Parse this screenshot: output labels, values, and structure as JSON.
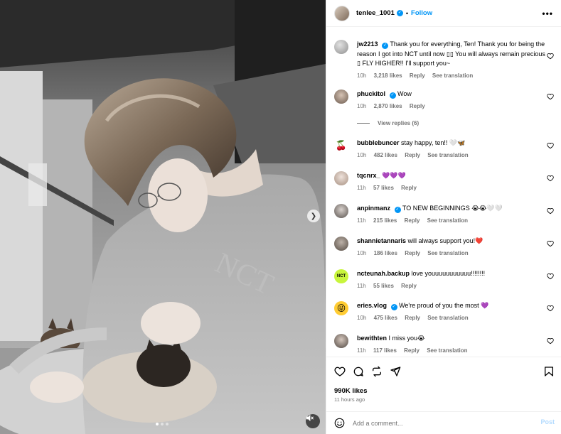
{
  "post": {
    "author": "tenlee_1001",
    "separator": "•",
    "follow_label": "Follow",
    "more_label": "•••",
    "likes": "990K likes",
    "time_ago": "11 hours ago",
    "comment_placeholder": "Add a comment...",
    "post_label": "Post",
    "carousel_count": 3,
    "carousel_active": 0
  },
  "comments": [
    {
      "user": "jw2213",
      "verified": true,
      "text": "Thank you for everything, Ten! Thank you for being the reason I got into NCT until now ▯▯ You will always remain precious ▯ FLY HIGHER!! I'll support you~",
      "time": "10h",
      "likes": "3,218 likes",
      "reply": "Reply",
      "translate": "See translation"
    },
    {
      "user": "phuckitol",
      "verified": true,
      "text": "Wow",
      "time": "10h",
      "likes": "2,870 likes",
      "reply": "Reply",
      "translate": ""
    },
    {
      "user": "bubblebuncer",
      "verified": false,
      "text": "stay happy, ten!! 🤍🦋",
      "time": "10h",
      "likes": "482 likes",
      "reply": "Reply",
      "translate": "See translation"
    },
    {
      "user": "tqcnrx_",
      "verified": false,
      "text": "💜💜💜",
      "time": "11h",
      "likes": "57 likes",
      "reply": "Reply",
      "translate": ""
    },
    {
      "user": "anpinmanz",
      "verified": true,
      "text": "TO NEW BEGINNINGS 😭😭🤍🤍",
      "time": "11h",
      "likes": "215 likes",
      "reply": "Reply",
      "translate": "See translation"
    },
    {
      "user": "shannietannaris",
      "verified": false,
      "text": "will always support you!❤️",
      "time": "10h",
      "likes": "186 likes",
      "reply": "Reply",
      "translate": "See translation"
    },
    {
      "user": "ncteunah.backup",
      "verified": false,
      "text": "love youuuuuuuuuuu!!!!!!!!",
      "time": "11h",
      "likes": "55 likes",
      "reply": "Reply",
      "translate": ""
    },
    {
      "user": "eries.vlog",
      "verified": true,
      "text": "We're proud of you the most 💜",
      "time": "10h",
      "likes": "475 likes",
      "reply": "Reply",
      "translate": "See translation"
    },
    {
      "user": "bewithten",
      "verified": false,
      "text": "I miss you😭",
      "time": "11h",
      "likes": "117 likes",
      "reply": "Reply",
      "translate": "See translation"
    }
  ],
  "view_replies": "View replies (6)",
  "avatar_texts": {
    "nct": "NCT"
  },
  "icons": [
    "heart-icon",
    "comment-icon",
    "share-icon",
    "send-icon",
    "bookmark-icon",
    "emoji-icon",
    "mute-icon",
    "chevron-right-icon",
    "verified-icon"
  ],
  "colors": {
    "link": "#0095f6",
    "muted": "#737373",
    "border": "#efefef",
    "post_disabled": "#b3dbff"
  }
}
